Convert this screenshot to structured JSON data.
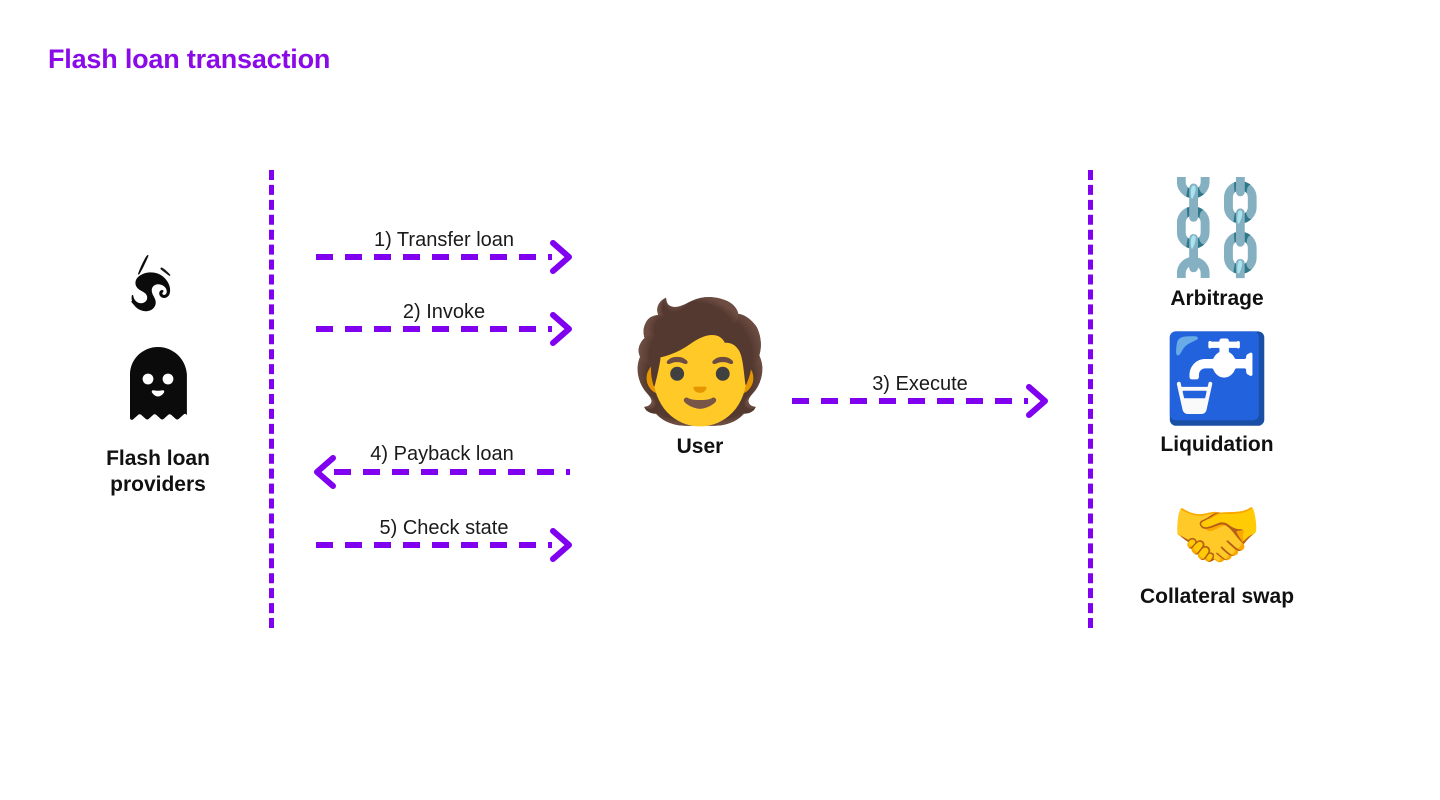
{
  "page": {
    "title": "Flash loan transaction",
    "background": "#ffffff",
    "accent_purple": "#8000f0",
    "title_purple": "#8a0ae8",
    "text_color": "#111111"
  },
  "actors": {
    "left": {
      "id": "flash-loan-providers",
      "label": "Flash loan\nproviders",
      "icons": [
        {
          "name": "uniswap-unicorn-logo",
          "glyph": ""
        },
        {
          "name": "aave-ghost-logo",
          "glyph": ""
        }
      ]
    },
    "center": {
      "id": "user",
      "label": "User",
      "icons": [
        {
          "name": "person-emoji",
          "glyph": "🧑"
        }
      ]
    },
    "right_items": [
      {
        "id": "arbitrage",
        "label": "Arbitrage",
        "icon_name": "chains-emoji",
        "glyph": "⛓️"
      },
      {
        "id": "liquidation",
        "label": "Liquidation",
        "icon_name": "potable-water-emoji",
        "glyph": "🚰"
      },
      {
        "id": "collateral-swap",
        "label": "Collateral swap",
        "icon_name": "handshake-emoji",
        "glyph": "🤝"
      }
    ]
  },
  "messages": [
    {
      "id": "msg-1",
      "label": "1) Transfer loan",
      "direction": "right",
      "from": "flash-loan-providers",
      "to": "user"
    },
    {
      "id": "msg-2",
      "label": "2) Invoke",
      "direction": "right",
      "from": "flash-loan-providers",
      "to": "user"
    },
    {
      "id": "msg-3",
      "label": "3) Execute",
      "direction": "right",
      "from": "user",
      "to": "protocols"
    },
    {
      "id": "msg-4",
      "label": "4) Payback loan",
      "direction": "left",
      "from": "user",
      "to": "flash-loan-providers"
    },
    {
      "id": "msg-5",
      "label": "5) Check state",
      "direction": "right",
      "from": "flash-loan-providers",
      "to": "user"
    }
  ]
}
